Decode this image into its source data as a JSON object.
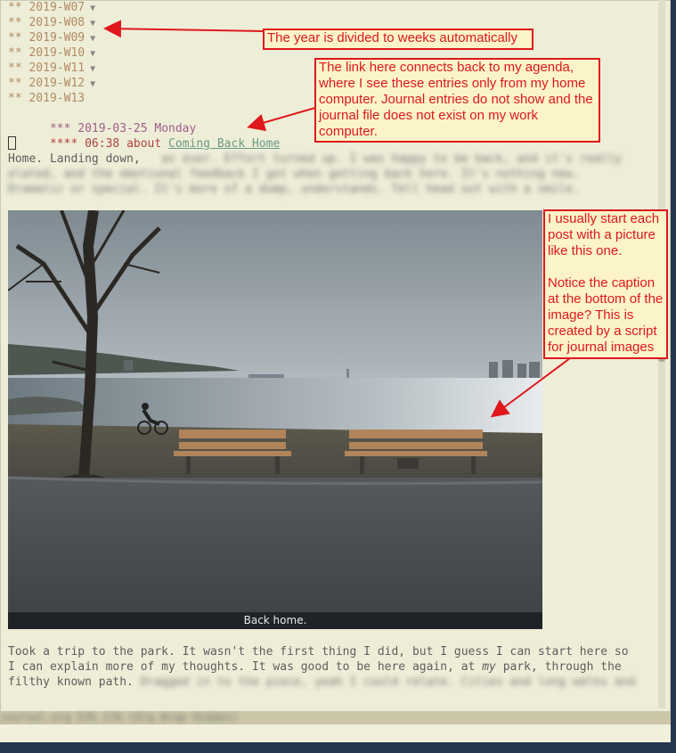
{
  "weeks": [
    {
      "stars": "**",
      "label": "2019-W07"
    },
    {
      "stars": "**",
      "label": "2019-W08"
    },
    {
      "stars": "**",
      "label": "2019-W09"
    },
    {
      "stars": "**",
      "label": "2019-W10"
    },
    {
      "stars": "**",
      "label": "2019-W11"
    },
    {
      "stars": "**",
      "label": "2019-W12"
    },
    {
      "stars": "**",
      "label": "2019-W13"
    }
  ],
  "fold_marker": "▼",
  "day_heading": {
    "stars": "***",
    "text": "2019-03-25 Monday"
  },
  "entry_heading": {
    "stars": "****",
    "time": "06:38",
    "about": "about",
    "link": "Coming Back Home"
  },
  "intro_line": "Home. Landing down,",
  "intro_blur": [
    "as ever. Effort turned up. I was happy to be back, and it's really",
    "elated, and the emotional feedback I got when getting back here. It's nothing new.",
    "Dramatic or special. It's more of a dump, understands. Tell head out with a smile."
  ],
  "photo_caption": "Back home.",
  "para_lines": [
    "Took a trip to the park. It wasn't the first thing I did, but I guess I can start here so",
    "I can explain more of my thoughts. It was good to be here again, at ",
    "filthy known path."
  ],
  "para_em": "my",
  "para_after_em": " park, through the",
  "para_blur": "Dragged in to the piece, yeah I could relate. Cities and long walks and",
  "modeline_text": "   journal.org    53% 176     (Org Wrap Hidden)",
  "annotations": {
    "weeks_note": "The year is divided to weeks automatically",
    "link_note": "The link here connects back to my agenda, where I see these entries only from my home computer. Journal entries do not show and the journal file does not exist on my work computer.",
    "image_note": "I usually start each post with a picture like this one.\n\nNotice the caption at the bottom of the image? This is created by a script for journal images"
  },
  "colors": {
    "accent_red": "#e0181c",
    "background": "#eeeed8"
  }
}
